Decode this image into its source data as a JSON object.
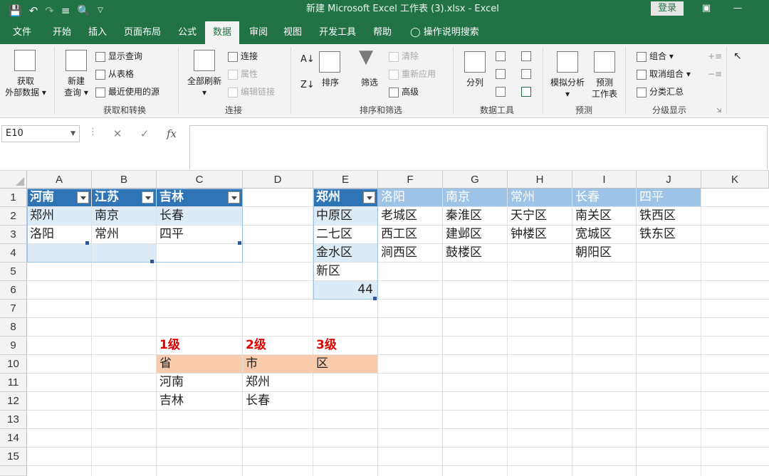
{
  "title_bar": {
    "title": "新建 Microsoft Excel 工作表 (3).xlsx  -  Excel",
    "login": "登录"
  },
  "tabs": [
    "文件",
    "开始",
    "插入",
    "页面布局",
    "公式",
    "数据",
    "审阅",
    "视图",
    "开发工具",
    "帮助"
  ],
  "active_tab": "数据",
  "tell_me": "操作说明搜索",
  "ribbon": {
    "get_external": [
      "获取",
      "外部数据 ▾"
    ],
    "new_query": [
      "新建",
      "查询 ▾"
    ],
    "show_query": "显示查询",
    "from_table": "从表格",
    "recent_sources": "最近使用的源",
    "group_get_transform": "获取和转换",
    "refresh_all": [
      "全部刷新",
      "▾"
    ],
    "connections": "连接",
    "properties": "属性",
    "edit_links": "编辑链接",
    "group_connections": "连接",
    "sort": "排序",
    "filter": "筛选",
    "clear": "清除",
    "reapply": "重新应用",
    "advanced": "高级",
    "group_sort_filter": "排序和筛选",
    "text_to_columns": "分列",
    "group_data_tools": "数据工具",
    "what_if": [
      "模拟分析",
      "▾"
    ],
    "forecast_sheet": [
      "预测",
      "工作表"
    ],
    "group_forecast": "预测",
    "group": "组合",
    "ungroup": "取消组合",
    "subtotal": "分类汇总",
    "group_outline": "分级显示"
  },
  "formula_bar": {
    "name_box": "E10",
    "cancel": "✕",
    "enter": "✓",
    "fx": "fx",
    "value": ""
  },
  "columns": [
    "A",
    "B",
    "C",
    "D",
    "E",
    "F",
    "G",
    "H",
    "I",
    "J",
    "K"
  ],
  "rows": [
    "1",
    "2",
    "3",
    "4",
    "5",
    "6",
    "7",
    "8",
    "9",
    "10",
    "11",
    "12",
    "13",
    "14",
    "15"
  ],
  "cells": {
    "A1": "河南",
    "B1": "江苏",
    "C1": "吉林",
    "A2": "郑州",
    "B2": "南京",
    "C2": "长春",
    "A3": "洛阳",
    "B3": "常州",
    "C3": "四平",
    "E1": "郑州",
    "F1": "洛阳",
    "G1": "南京",
    "H1": "常州",
    "I1": "长春",
    "J1": "四平",
    "E2": "中原区",
    "F2": "老城区",
    "G2": "秦淮区",
    "H2": "天宁区",
    "I2": "南关区",
    "J2": "铁西区",
    "E3": "二七区",
    "F3": "西工区",
    "G3": "建邺区",
    "H3": "钟楼区",
    "I3": "宽城区",
    "J3": "铁东区",
    "E4": "金水区",
    "F4": "涧西区",
    "G4": "鼓楼区",
    "I4": "朝阳区",
    "E5": "新区",
    "E6": "44",
    "C8": "1级",
    "D8": "2级",
    "E8": "3级",
    "C9": "省",
    "D9": "市",
    "E9": "区",
    "C10": "河南",
    "D10": "郑州",
    "C11": "吉林",
    "D11": "长春"
  }
}
